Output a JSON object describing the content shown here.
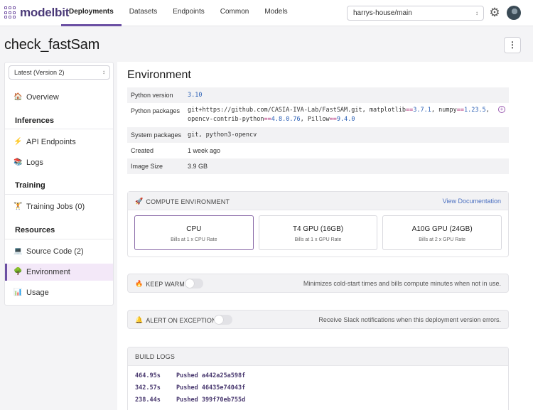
{
  "brand": {
    "name": "modelbit"
  },
  "nav": {
    "tabs": [
      "Deployments",
      "Datasets",
      "Endpoints",
      "Common",
      "Models"
    ],
    "active": "Deployments"
  },
  "branch": {
    "value": "harrys-house/main"
  },
  "page": {
    "title": "check_fastSam"
  },
  "sidebar": {
    "version": "Latest (Version 2)",
    "overview": "Overview",
    "sections": {
      "inferences": "Inferences",
      "training": "Training",
      "resources": "Resources"
    },
    "items": {
      "api_endpoints": "API Endpoints",
      "logs": "Logs",
      "training_jobs": "Training Jobs (0)",
      "source_code": "Source Code (2)",
      "environment": "Environment",
      "usage": "Usage"
    }
  },
  "environment": {
    "title": "Environment",
    "rows": {
      "python_version": {
        "key": "Python version",
        "value": "3.10"
      },
      "python_packages": {
        "key": "Python packages",
        "parts": {
          "p1": "git+https://github.com/CASIA-IVA-Lab/FastSAM.git, matplotlib",
          "op1": "==",
          "v1": "3.7.1",
          "p2": ", numpy",
          "op2": "==",
          "v2": "1.23.5",
          "p3": ",",
          "p4": "opencv-contrib-python",
          "op3": "==",
          "v3": "4.8.0.76",
          "p5": ", Pillow",
          "op4": "==",
          "v4": "9.4.0"
        }
      },
      "system_packages": {
        "key": "System packages",
        "value": "git, python3-opencv"
      },
      "created": {
        "key": "Created",
        "value": "1 week ago"
      },
      "image_size": {
        "key": "Image Size",
        "value": "3.9 GB"
      }
    }
  },
  "compute": {
    "header": "COMPUTE ENVIRONMENT",
    "doc_link": "View Documentation",
    "options": [
      {
        "name": "CPU",
        "sub": "Bills at 1 x CPU Rate"
      },
      {
        "name": "T4 GPU (16GB)",
        "sub": "Bills at 1 x GPU Rate"
      },
      {
        "name": "A10G GPU (24GB)",
        "sub": "Bills at 2 x GPU Rate"
      }
    ],
    "selected": "CPU"
  },
  "keep_warm": {
    "label": "KEEP WARM",
    "description": "Minimizes cold-start times and bills compute minutes when not in use.",
    "enabled": false
  },
  "alert": {
    "label": "ALERT ON EXCEPTION",
    "description": "Receive Slack notifications when this deployment version errors.",
    "enabled": false
  },
  "build_logs": {
    "header": "BUILD LOGS",
    "lines": [
      {
        "time": "464.95s",
        "text": "Pushed a442a25a598f"
      },
      {
        "time": "342.57s",
        "text": "Pushed 46435e74043f"
      },
      {
        "time": "238.44s",
        "text": "Pushed 399f70eb755d"
      }
    ]
  },
  "colors": {
    "accent": "#6b4fa3",
    "link": "#4a6fc0",
    "active_bg": "#f3e8f8"
  },
  "icons": {
    "overview": "house-icon",
    "api_endpoints": "lightning-icon",
    "logs": "books-icon",
    "training_jobs": "weightlifter-icon",
    "source_code": "laptop-icon",
    "environment": "tree-icon",
    "usage": "bar-chart-icon",
    "compute": "rocket-icon",
    "keep_warm": "fire-icon",
    "alert": "bell-icon"
  }
}
